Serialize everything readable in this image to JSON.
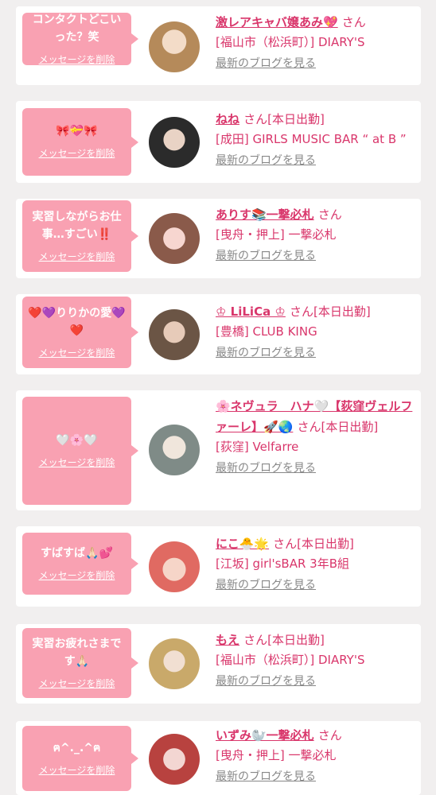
{
  "san_label": "さん",
  "delete_label": "メッセージを削除",
  "blog_label": "最新のブログを見る",
  "colors": {
    "accent": "#d9366b",
    "bubble": "#f9a1b2",
    "background": "#f1efef"
  },
  "cards": [
    {
      "message": "コンタクトどこいった？笑",
      "name": "激レアキャバ嬢あみ💖",
      "status": "",
      "shop": "[福山市（松浜町）] DIARY'S"
    },
    {
      "message": "🎀💝🎀",
      "name": "ねね",
      "status": "[本日出勤]",
      "shop": "[成田] GIRLS MUSIC BAR “ at B ”"
    },
    {
      "message": "実習しながらお仕事…すごい‼️",
      "name": "ありす📚一撃必札",
      "status": "",
      "shop": "[曳舟・押上] 一撃必札"
    },
    {
      "message": "❤️💜りりかの愛💜❤️",
      "name": "♔ LiLiCa ♔",
      "status": "[本日出勤]",
      "shop": "[豊橋] CLUB KING"
    },
    {
      "message": "🤍🌸🤍",
      "name": "🌸ネヴュラ　ハナ🤍【荻窪ヴェルファーレ】🚀🌏",
      "status": "[本日出勤]",
      "shop": "[荻窪] Velfarre"
    },
    {
      "message": "すばすば🙏🏻💕",
      "name": "にこ🐣🌟",
      "status": "[本日出勤]",
      "shop": "[江坂] girl'sBAR 3年B組"
    },
    {
      "message": "実習お疲れさまです🙏🏻",
      "name": "もえ",
      "status": "[本日出勤]",
      "shop": "[福山市（松浜町）] DIARY'S"
    },
    {
      "message": "ฅ^._.^ฅ",
      "name": "いずみ🦭一撃必札",
      "status": "",
      "shop": "[曳舟・押上] 一撃必札"
    }
  ]
}
